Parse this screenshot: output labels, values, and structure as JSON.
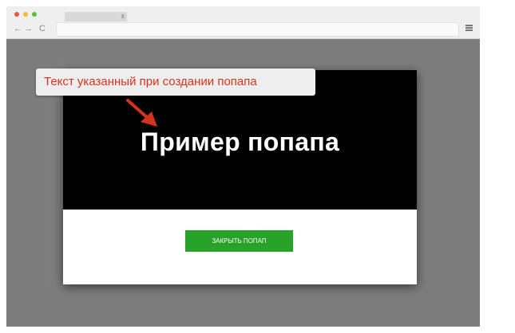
{
  "browser": {
    "tab": {
      "close_label": "x"
    },
    "nav": {
      "back": "←",
      "forward": "→",
      "reload": "C"
    },
    "address": {
      "value": ""
    },
    "window_buttons": {
      "close_color": "#f0563e",
      "minimize_color": "#f5b82e",
      "maximize_color": "#55c13e"
    }
  },
  "popup": {
    "title": "Пример попапа",
    "close_button_label": "ЗАКРЫТЬ ПОПАП",
    "close_button_color": "#28a228"
  },
  "annotation": {
    "text": "Текст указанный при создании попапа",
    "color": "#d6331e"
  }
}
